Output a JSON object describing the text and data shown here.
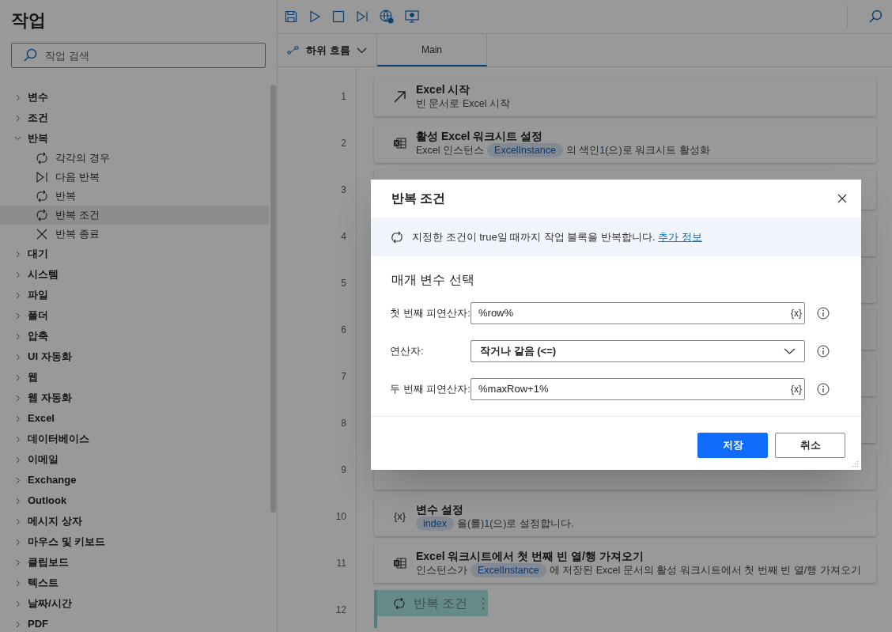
{
  "sidebar": {
    "title": "작업",
    "search": {
      "placeholder": "작업 검색"
    },
    "items": [
      {
        "label": "변수",
        "expanded": false
      },
      {
        "label": "조건",
        "expanded": false
      },
      {
        "label": "반복",
        "expanded": true,
        "children": [
          {
            "label": "각각의 경우",
            "kind": "loop",
            "selected": false
          },
          {
            "label": "다음 반복",
            "kind": "next",
            "selected": false
          },
          {
            "label": "반복",
            "kind": "loop",
            "selected": false
          },
          {
            "label": "반복 조건",
            "kind": "loop",
            "selected": true
          },
          {
            "label": "반복 종료",
            "kind": "exit",
            "selected": false
          }
        ]
      },
      {
        "label": "대기",
        "expanded": false
      },
      {
        "label": "시스템",
        "expanded": false
      },
      {
        "label": "파일",
        "expanded": false
      },
      {
        "label": "폴더",
        "expanded": false
      },
      {
        "label": "압축",
        "expanded": false
      },
      {
        "label": "UI 자동화",
        "expanded": false
      },
      {
        "label": "웹",
        "expanded": false
      },
      {
        "label": "웹 자동화",
        "expanded": false
      },
      {
        "label": "Excel",
        "expanded": false
      },
      {
        "label": "데이터베이스",
        "expanded": false
      },
      {
        "label": "이메일",
        "expanded": false
      },
      {
        "label": "Exchange",
        "expanded": false
      },
      {
        "label": "Outlook",
        "expanded": false
      },
      {
        "label": "메시지 상자",
        "expanded": false
      },
      {
        "label": "마우스 및 키보드",
        "expanded": false
      },
      {
        "label": "클립보드",
        "expanded": false
      },
      {
        "label": "텍스트",
        "expanded": false
      },
      {
        "label": "날짜/시간",
        "expanded": false
      },
      {
        "label": "PDF",
        "expanded": false
      }
    ]
  },
  "subflows": {
    "label": "하위 흐름"
  },
  "tabs": [
    {
      "label": "Main",
      "selected": true
    }
  ],
  "steps": [
    {
      "number": "1",
      "kind": "launch",
      "title": "Excel 시작",
      "description": [
        {
          "kind": "text",
          "text": "빈 문서로 Excel 시작"
        }
      ]
    },
    {
      "number": "2",
      "kind": "sheet",
      "title": "활성 Excel 워크시트 설정",
      "description": [
        {
          "kind": "text",
          "text": "Excel 인스턴스"
        },
        {
          "kind": "var",
          "text": "ExcelInstance"
        },
        {
          "kind": "text",
          "text": "의 색인"
        },
        {
          "kind": "num",
          "text": "1"
        },
        {
          "kind": "text",
          "text": "(으)로 워크시트 활성화"
        }
      ]
    },
    {
      "number": "3",
      "kind": "hidden"
    },
    {
      "number": "4",
      "kind": "hidden"
    },
    {
      "number": "5",
      "kind": "hidden"
    },
    {
      "number": "6",
      "kind": "hidden"
    },
    {
      "number": "7",
      "kind": "hidden"
    },
    {
      "number": "8",
      "kind": "hidden"
    },
    {
      "number": "9",
      "kind": "hidden"
    },
    {
      "number": "10",
      "kind": "variable",
      "icon_text": "{x}",
      "title": "변수 설정",
      "description": [
        {
          "kind": "var",
          "text": "index"
        },
        {
          "kind": "text",
          "text": "을(를)"
        },
        {
          "kind": "num",
          "text": "1"
        },
        {
          "kind": "text",
          "text": "(으)로 설정합니다."
        }
      ]
    },
    {
      "number": "11",
      "kind": "sheet",
      "title": "Excel 워크시트에서 첫 번째 빈 열/행 가져오기",
      "description": [
        {
          "kind": "text",
          "text": "인스턴스가"
        },
        {
          "kind": "var",
          "text": "ExcelInstance"
        },
        {
          "kind": "text",
          "text": "에 저장된 Excel 문서의 활성 워크시트에서 첫 번째 빈 열/행 가져오기"
        }
      ]
    },
    {
      "number": "12",
      "kind": "ghost",
      "title": "반복 조건"
    }
  ],
  "dialog": {
    "title": "반복 조건",
    "info": "지정한 조건이 true일 때까지 작업 블록을 반복합니다.",
    "info_link": "추가 정보",
    "section": "매개 변수 선택",
    "fields": [
      {
        "label": "첫 번째 피연산자:",
        "kind": "input",
        "value": "%row%",
        "variable_button": "{x}"
      },
      {
        "label": "연산자:",
        "kind": "select",
        "value": "작거나 같음 (<=)"
      },
      {
        "label": "두 번째 피연산자:",
        "kind": "input",
        "value": "%maxRow+1%",
        "variable_button": "{x}"
      }
    ],
    "buttons": [
      {
        "label": "저장",
        "kind": "primary"
      },
      {
        "label": "취소",
        "kind": "secondary"
      }
    ]
  }
}
